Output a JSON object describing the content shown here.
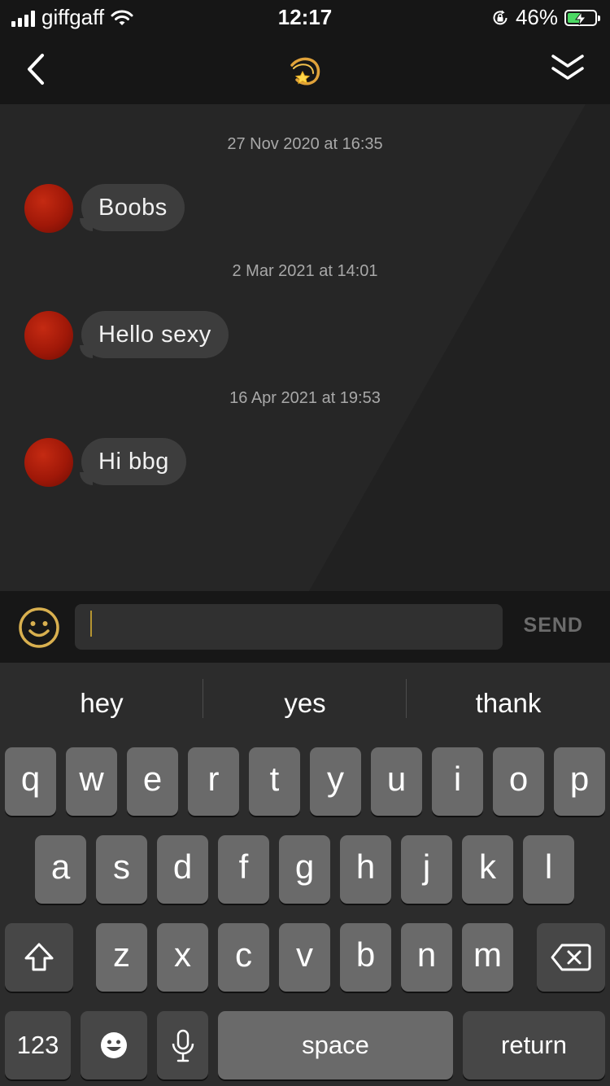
{
  "status_bar": {
    "carrier": "giffgaff",
    "time": "12:17",
    "battery_percent": "46%",
    "battery_level": 0.46,
    "icons": [
      "signal-icon",
      "wifi-icon",
      "rotation-lock-icon",
      "battery-charging-icon"
    ]
  },
  "nav": {
    "back_icon": "chevron-left-icon",
    "title_icon": "dizzy-star-icon",
    "more_icon": "double-chevron-down-icon"
  },
  "messages": [
    {
      "timestamp": "27 Nov 2020 at 16:35",
      "text": "Boobs"
    },
    {
      "timestamp": "2 Mar 2021 at 14:01",
      "text": "Hello sexy"
    },
    {
      "timestamp": "16 Apr 2021 at 19:53",
      "text": "Hi bbg"
    }
  ],
  "composer": {
    "emoji_icon": "smiley-icon",
    "input_value": "",
    "send_label": "SEND"
  },
  "keyboard": {
    "suggestions": [
      "hey",
      "yes",
      "thank"
    ],
    "row1": [
      "q",
      "w",
      "e",
      "r",
      "t",
      "y",
      "u",
      "i",
      "o",
      "p"
    ],
    "row2": [
      "a",
      "s",
      "d",
      "f",
      "g",
      "h",
      "j",
      "k",
      "l"
    ],
    "row3": [
      "z",
      "x",
      "c",
      "v",
      "b",
      "n",
      "m"
    ],
    "numbers_label": "123",
    "space_label": "space",
    "return_label": "return"
  },
  "colors": {
    "accent": "#d9b04f",
    "chat_background": "#262626",
    "bubble": "#3d3d3d",
    "battery_fill": "#4cd964",
    "avatar": "#b3200c"
  }
}
